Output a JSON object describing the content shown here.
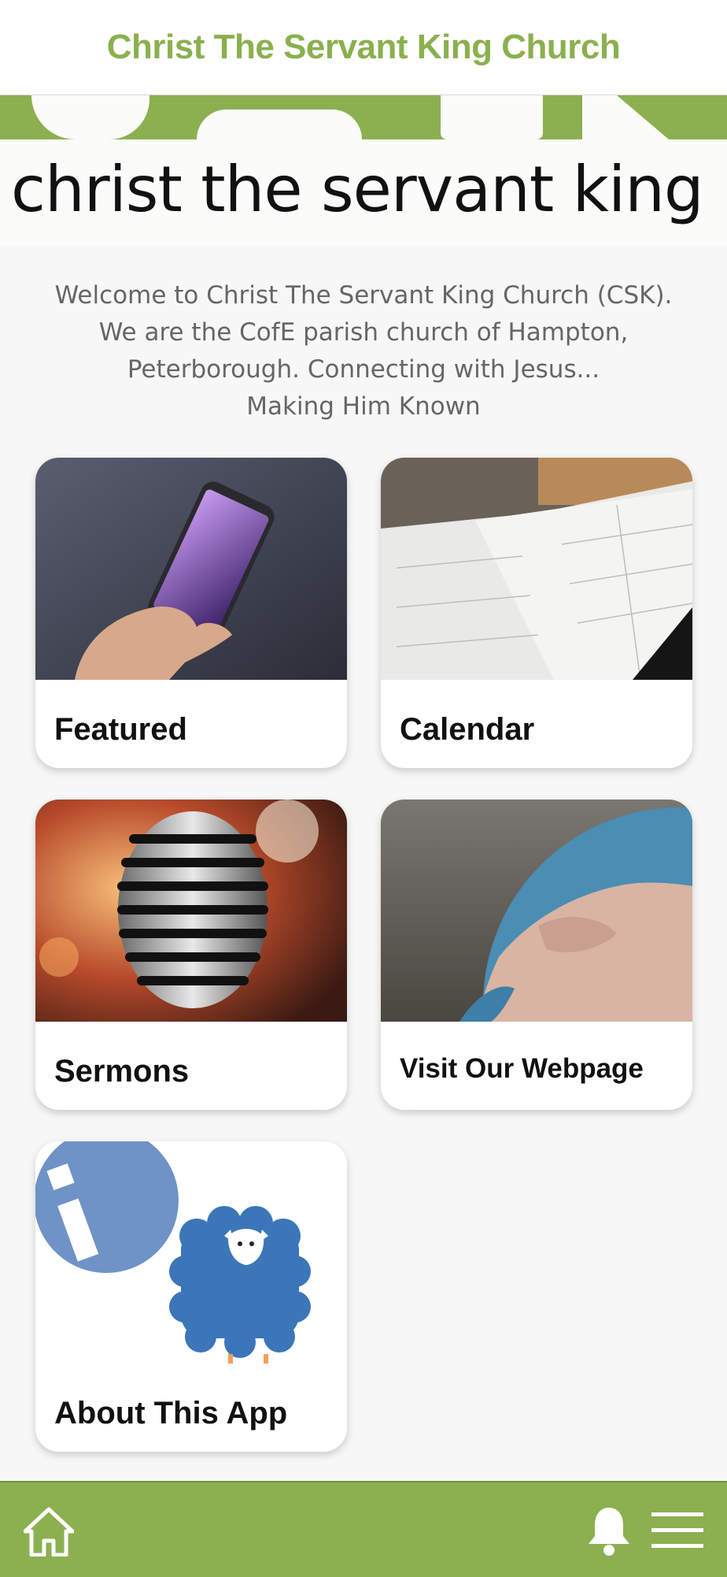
{
  "header": {
    "title": "Christ The Servant King Church"
  },
  "banner": {
    "text": "christ the servant king"
  },
  "welcome": {
    "lines": [
      "Welcome to Christ The Servant King Church (CSK).",
      "We are the CofE parish church of Hampton,",
      "Peterborough. Connecting with Jesus...",
      "Making Him Known"
    ]
  },
  "tiles": [
    {
      "label": "Featured"
    },
    {
      "label": "Calendar"
    },
    {
      "label": "Sermons"
    },
    {
      "label": "Visit Our Webpage"
    },
    {
      "label": "About This App"
    }
  ],
  "colors": {
    "brand": "#8bb04f",
    "info_blue": "#6f93c6",
    "sheep_blue": "#3b76b9"
  },
  "icons": {
    "tile1": "smartphone-photo",
    "tile2": "calendar-book-photo",
    "tile3": "microphone-photo",
    "tile4": "globe-photo",
    "tile5": "info-sheep-illustration",
    "nav_home": "home-icon",
    "nav_bell": "bell-icon",
    "nav_menu": "menu-icon"
  }
}
